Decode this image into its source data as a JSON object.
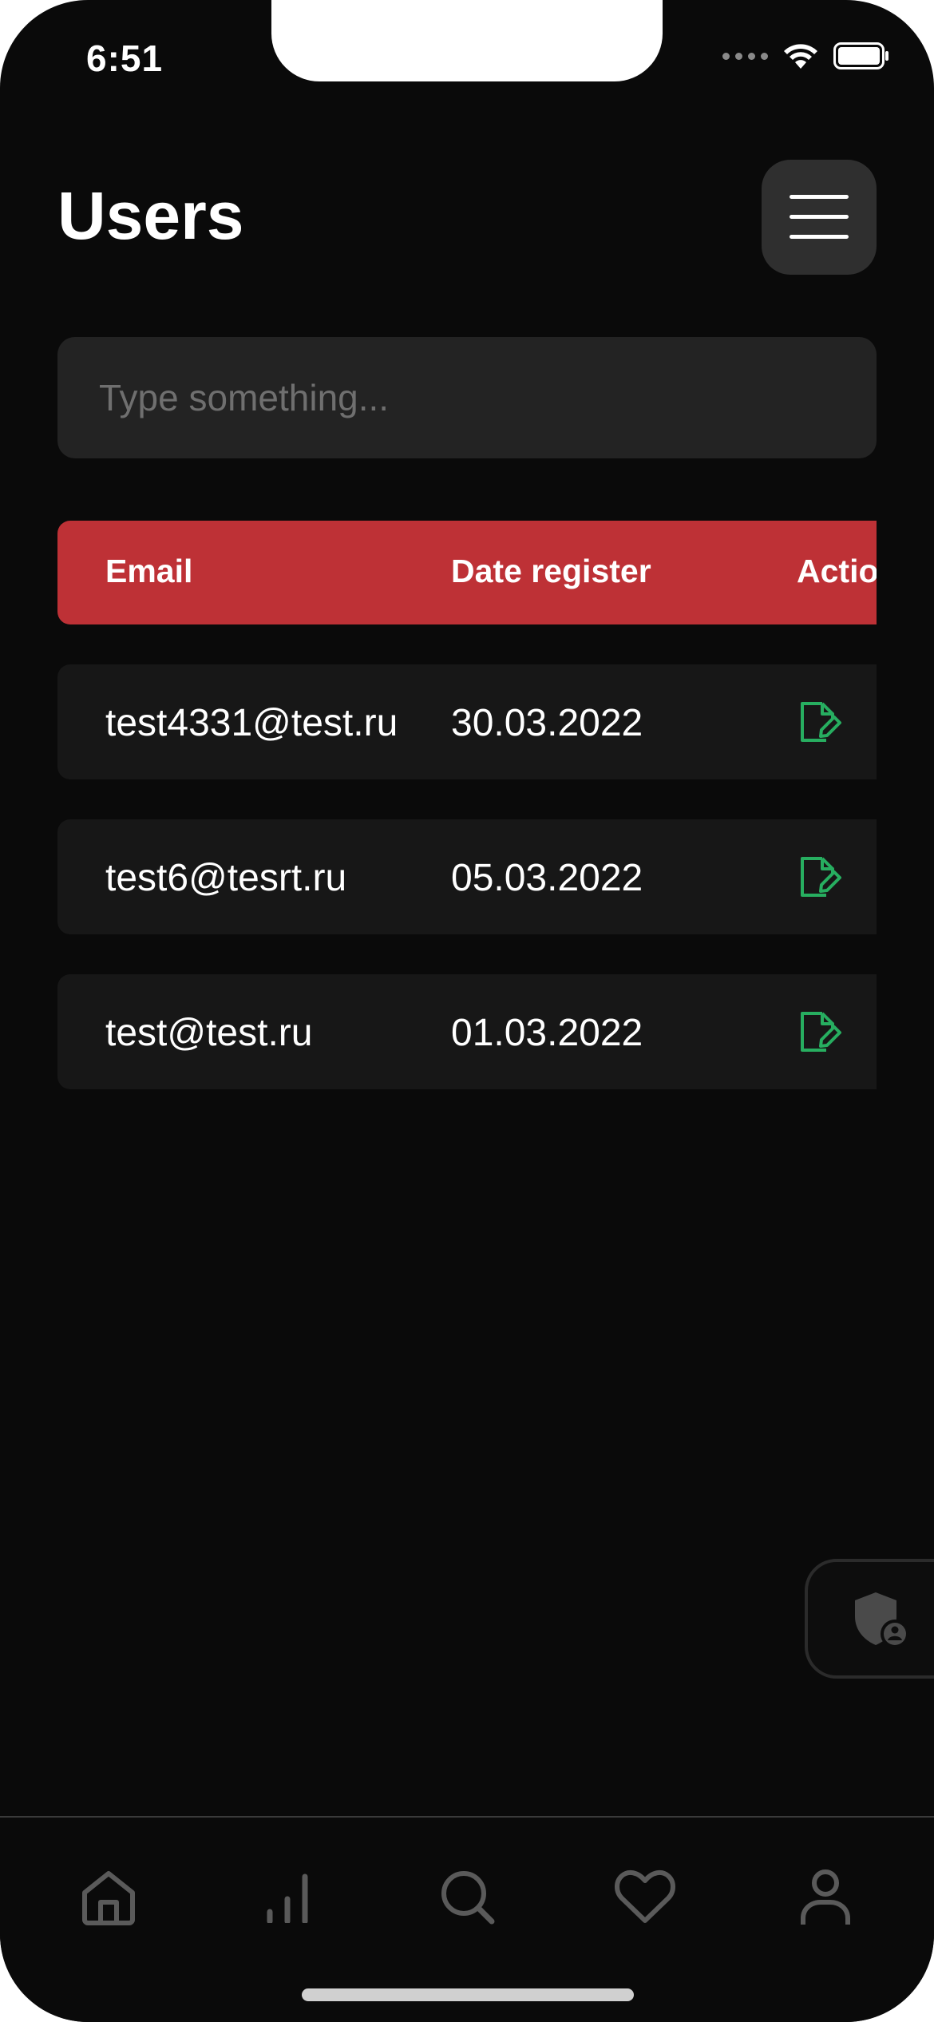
{
  "status_bar": {
    "time": "6:51"
  },
  "header": {
    "title": "Users"
  },
  "search": {
    "placeholder": "Type something..."
  },
  "table": {
    "headers": [
      "Email",
      "Date register",
      "Actions"
    ],
    "rows": [
      {
        "email": "test4331@test.ru",
        "date": "30.03.2022"
      },
      {
        "email": "test6@tesrt.ru",
        "date": "05.03.2022"
      },
      {
        "email": "test@test.ru",
        "date": "01.03.2022"
      }
    ]
  },
  "colors": {
    "background": "#0a0a0a",
    "header_accent": "#be3136",
    "edit_icon": "#27ae60",
    "row_bg": "#171717"
  },
  "icons": {
    "menu": "hamburger-icon",
    "edit": "edit-document-icon",
    "admin": "shield-user-icon",
    "nav": [
      "home-icon",
      "stats-icon",
      "search-icon",
      "heart-icon",
      "profile-icon"
    ]
  }
}
